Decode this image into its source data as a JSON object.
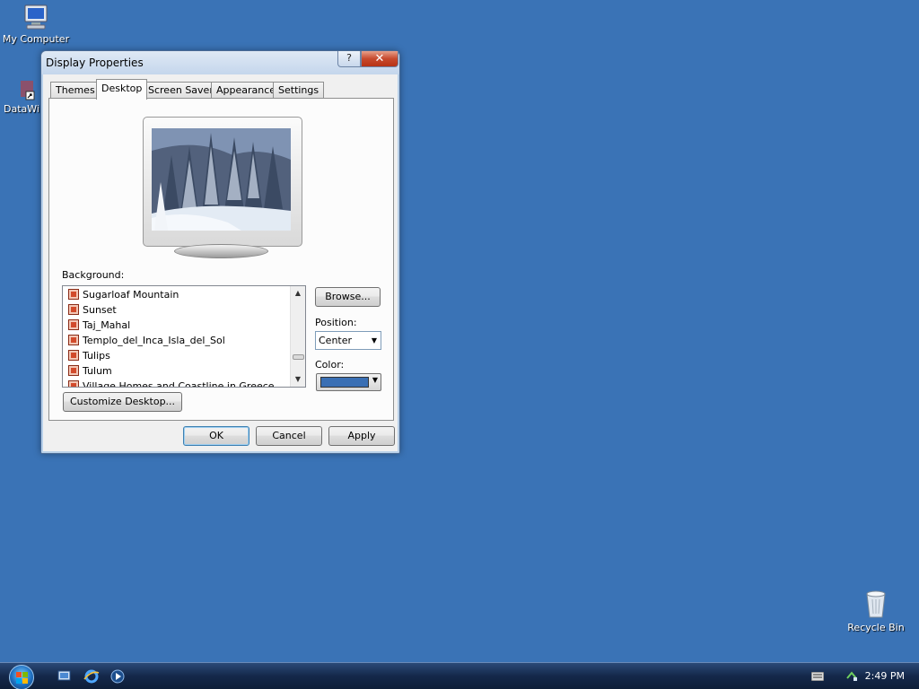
{
  "desktop": {
    "icons": [
      {
        "label": "My Computer"
      },
      {
        "label": "DataWi"
      },
      {
        "label": "Recycle Bin"
      }
    ]
  },
  "dialog": {
    "title": "Display Properties",
    "help_glyph": "?",
    "close_glyph": "✕",
    "tabs": [
      {
        "label": "Themes"
      },
      {
        "label": "Desktop"
      },
      {
        "label": "Screen Saver"
      },
      {
        "label": "Appearance"
      },
      {
        "label": "Settings"
      }
    ],
    "active_tab": "Desktop",
    "background_label": "Background:",
    "background_items": [
      {
        "label": "Sugarloaf Mountain"
      },
      {
        "label": "Sunset"
      },
      {
        "label": "Taj_Mahal"
      },
      {
        "label": "Templo_del_Inca_Isla_del_Sol"
      },
      {
        "label": "Tulips"
      },
      {
        "label": "Tulum"
      },
      {
        "label": "Village Homes and Coastline in Greece"
      }
    ],
    "browse_label": "Browse...",
    "position_label": "Position:",
    "position_value": "Center",
    "color_label": "Color:",
    "color_value": "#3a6fb4",
    "customize_label": "Customize Desktop...",
    "ok_label": "OK",
    "cancel_label": "Cancel",
    "apply_label": "Apply"
  },
  "taskbar": {
    "clock": "2:49 PM",
    "quick_launch": [
      "show-desktop-icon",
      "internet-explorer-icon",
      "media-player-icon"
    ]
  },
  "colors": {
    "desktop_bg": "#3a73b6",
    "selected_color": "#3a6fb4"
  }
}
